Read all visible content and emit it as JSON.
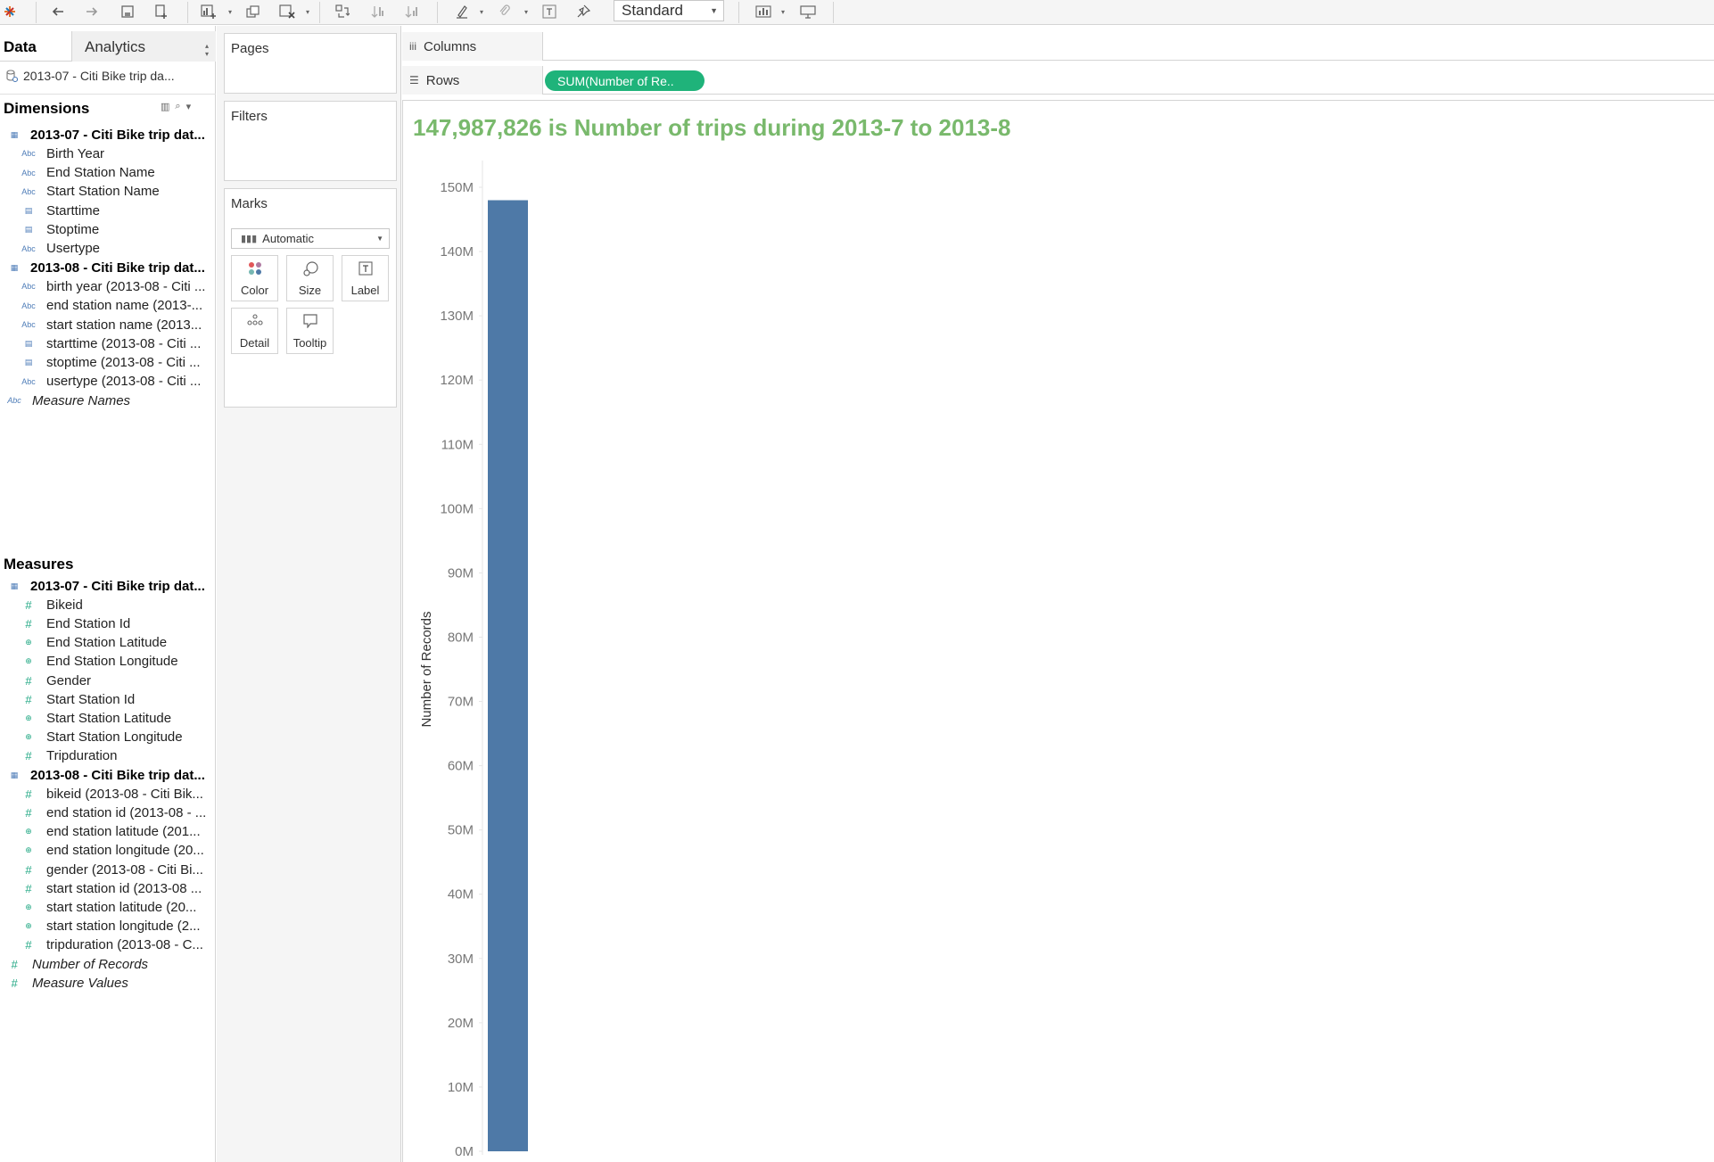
{
  "toolbar": {
    "fit": "Standard",
    "icons": [
      "tableau-logo-icon",
      "undo-icon",
      "redo-icon",
      "save-icon",
      "new-datasource-icon",
      "new-worksheet-icon",
      "duplicate-icon",
      "clear-icon",
      "swap-icon",
      "sort-asc-icon",
      "sort-desc-icon",
      "highlight-icon",
      "group-icon",
      "label-icon",
      "pin-icon",
      "show-me-icon",
      "presentation-icon"
    ]
  },
  "data_pane": {
    "tab_data": "Data",
    "tab_analytics": "Analytics",
    "datasource": "2013-07 - Citi Bike trip da...",
    "dimensions_title": "Dimensions",
    "dimensions": [
      {
        "label": "2013-07 - Citi Bike trip dat...",
        "type": "table",
        "group": true
      },
      {
        "label": "Birth Year",
        "type": "abc"
      },
      {
        "label": "End Station Name",
        "type": "abc"
      },
      {
        "label": "Start Station Name",
        "type": "abc"
      },
      {
        "label": "Starttime",
        "type": "date"
      },
      {
        "label": "Stoptime",
        "type": "date"
      },
      {
        "label": "Usertype",
        "type": "abc"
      },
      {
        "label": "2013-08 - Citi Bike trip dat...",
        "type": "table",
        "group": true
      },
      {
        "label": "birth year (2013-08 - Citi ...",
        "type": "abc"
      },
      {
        "label": "end station name (2013-...",
        "type": "abc"
      },
      {
        "label": "start station name (2013...",
        "type": "abc"
      },
      {
        "label": "starttime (2013-08 - Citi ...",
        "type": "date"
      },
      {
        "label": "stoptime (2013-08 - Citi ...",
        "type": "date"
      },
      {
        "label": "usertype (2013-08 - Citi ...",
        "type": "abc"
      },
      {
        "label": "Measure Names",
        "type": "abc",
        "italic": true,
        "top": true
      }
    ],
    "measures_title": "Measures",
    "measures": [
      {
        "label": "2013-07 - Citi Bike trip dat...",
        "type": "table",
        "group": true
      },
      {
        "label": "Bikeid",
        "type": "hash"
      },
      {
        "label": "End Station Id",
        "type": "hash"
      },
      {
        "label": "End Station Latitude",
        "type": "globe"
      },
      {
        "label": "End Station Longitude",
        "type": "globe"
      },
      {
        "label": "Gender",
        "type": "hash"
      },
      {
        "label": "Start Station Id",
        "type": "hash"
      },
      {
        "label": "Start Station Latitude",
        "type": "globe"
      },
      {
        "label": "Start Station Longitude",
        "type": "globe"
      },
      {
        "label": "Tripduration",
        "type": "hash"
      },
      {
        "label": "2013-08 - Citi Bike trip dat...",
        "type": "table",
        "group": true
      },
      {
        "label": "bikeid (2013-08 - Citi Bik...",
        "type": "hash"
      },
      {
        "label": "end station id (2013-08 - ...",
        "type": "hash"
      },
      {
        "label": "end station latitude (201...",
        "type": "globe"
      },
      {
        "label": "end station longitude (20...",
        "type": "globe"
      },
      {
        "label": "gender (2013-08 - Citi Bi...",
        "type": "hash"
      },
      {
        "label": "start station id (2013-08 ...",
        "type": "hash"
      },
      {
        "label": "start station latitude (20...",
        "type": "globe"
      },
      {
        "label": "start station longitude (2...",
        "type": "globe"
      },
      {
        "label": "tripduration (2013-08 - C...",
        "type": "hash"
      },
      {
        "label": "Number of Records",
        "type": "hash",
        "italic": true,
        "top": true
      },
      {
        "label": "Measure Values",
        "type": "hash",
        "italic": true,
        "top": true
      }
    ]
  },
  "cards": {
    "pages": "Pages",
    "filters": "Filters",
    "marks": "Marks",
    "mark_type": "Automatic",
    "mark_buttons": [
      "Color",
      "Size",
      "Label",
      "Detail",
      "Tooltip"
    ]
  },
  "shelves": {
    "columns_label": "Columns",
    "rows_label": "Rows",
    "rows_pill": "SUM(Number of Re.."
  },
  "viz": {
    "title": "147,987,826 is Number of trips during 2013-7 to 2013-8"
  },
  "chart_data": {
    "type": "bar",
    "categories": [
      ""
    ],
    "values": [
      147987826
    ],
    "ylabel": "Number of Records",
    "ylim": [
      0,
      150000000
    ],
    "yticks": [
      0,
      10000000,
      20000000,
      30000000,
      40000000,
      50000000,
      60000000,
      70000000,
      80000000,
      90000000,
      100000000,
      110000000,
      120000000,
      130000000,
      140000000,
      150000000
    ],
    "ytick_labels": [
      "0M",
      "10M",
      "20M",
      "30M",
      "40M",
      "50M",
      "60M",
      "70M",
      "80M",
      "90M",
      "100M",
      "110M",
      "120M",
      "130M",
      "140M",
      "150M"
    ],
    "bar_color": "#4e79a7",
    "grid": false
  },
  "colors": {
    "title": "#79b96c",
    "pill": "#1fb37a",
    "bar": "#4e79a7"
  }
}
